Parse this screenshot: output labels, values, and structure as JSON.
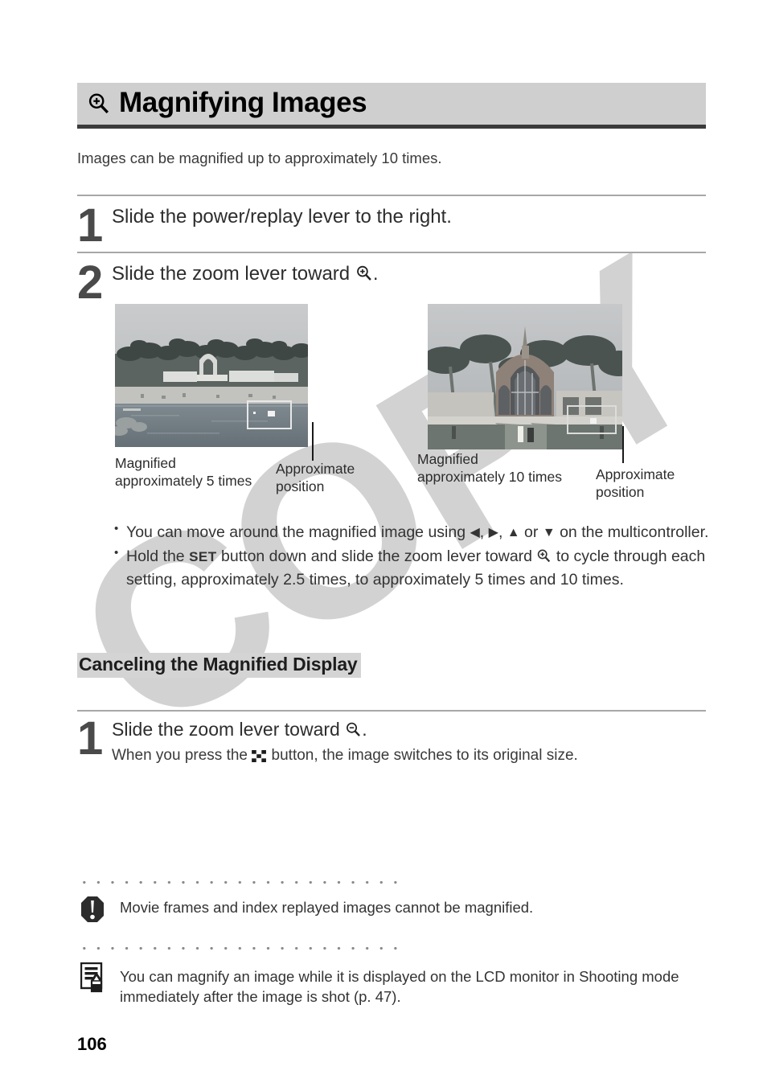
{
  "page": {
    "number": "106",
    "watermark": "COPY"
  },
  "header": {
    "title": "Magnifying Images",
    "icon": "magnifier-plus-icon"
  },
  "intro": "Images can be magnified up to approximately 10 times.",
  "steps": [
    {
      "number": "1",
      "text": "Slide the power/replay lever to the right."
    },
    {
      "number": "2",
      "text_before": "Slide the zoom lever toward ",
      "icon": "magnifier-plus-icon",
      "text_after": "."
    }
  ],
  "figures": [
    {
      "name": "magnified-5x-photo",
      "caption": "Magnified\napproximately 5 times",
      "caption_line1": "Magnified",
      "caption_line2": "approximately 5 times",
      "pointer_label_line1": "Approximate",
      "pointer_label_line2": "position"
    },
    {
      "name": "magnified-10x-photo",
      "caption_line1": "Magnified",
      "caption_line2": "approximately 10 times",
      "pointer_label_line1": "Approximate",
      "pointer_label_line2": "position"
    }
  ],
  "bullets": [
    {
      "part1": "You can move around the magnified image using ",
      "arrow_left": "◀",
      "sep1": ", ",
      "arrow_right": "▶",
      "sep2": ", ",
      "arrow_up": "▲",
      "sep3": " or ",
      "arrow_down": "▼",
      "part2": " on the multicontroller."
    },
    {
      "part1": "Hold the ",
      "key": "SET",
      "part2": " button down and slide the zoom lever toward ",
      "icon": "magnifier-plus-icon",
      "part3": " to cycle through each setting, approximately 2.5 times, to approximately 5 times and 10 times."
    }
  ],
  "subsection": {
    "heading": "Canceling the Magnified Display",
    "step": {
      "number": "1",
      "text_before": "Slide the zoom lever toward ",
      "icon": "magnifier-minus-icon",
      "text_after": ".",
      "detail_before": "When you press the ",
      "detail_icon": "index-display-icon",
      "detail_after": " button, the image switches to its original size."
    }
  },
  "notes": [
    {
      "icon": "warning-icon",
      "text": "Movie frames and index replayed images cannot be magnified."
    },
    {
      "icon": "memo-pencil-icon",
      "text": "You can magnify an image while it is displayed on the LCD monitor in Shooting mode immediately after the image is shot (p. 47)."
    }
  ],
  "colors": {
    "header_bg": "#cfcfcf",
    "header_rule": "#3b3b3b",
    "rule": "#a7a7a7",
    "watermark": "#d2d2d2",
    "step_number": "#4a4a4a"
  }
}
